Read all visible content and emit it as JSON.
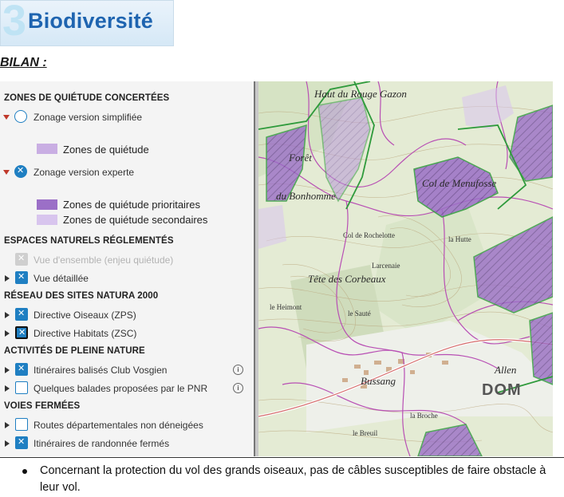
{
  "header": {
    "logo_number": "3",
    "logo_text": "Biodiversité",
    "bilan": "BILAN :"
  },
  "legend": {
    "zones_title": "ZONES DE QUIÉTUDE CONCERTÉES",
    "simplified_label": "Zonage version simplifiée",
    "zone_quietude": "Zones de quiétude",
    "expert_label": "Zonage version experte",
    "zone_prioritaires": "Zones de quiétude prioritaires",
    "zone_secondaires": "Zones de quiétude secondaires",
    "espaces_title": "ESPACES NATURELS RÉGLEMENTÉS",
    "vue_ensemble": "Vue d'ensemble (enjeu quiétude)",
    "vue_detaillee": "Vue détaillée",
    "natura_title": "RÉSEAU DES SITES NATURA 2000",
    "directive_oiseaux": "Directive Oiseaux (ZPS)",
    "directive_habitats": "Directive Habitats (ZSC)",
    "activites_title": "ACTIVITÉS DE PLEINE NATURE",
    "itineraires_club": "Itinéraires balisés Club Vosgien",
    "balades_pnr": "Quelques balades proposées par le PNR",
    "voies_title": "VOIES FERMÉES",
    "routes_dep": "Routes départementales non déneigées",
    "itineraires_fermes": "Itinéraires de randonnée fermés",
    "info_symbol": "i",
    "colors": {
      "quietude": "#c9aee3",
      "prioritaire": "#9b6fc7",
      "secondaire": "#d8c5ee",
      "accent": "#1f7fc2"
    }
  },
  "map": {
    "labels": {
      "haut_rouge_gazon": "Haut du Rouge Gazon",
      "foret": "Forêt",
      "du_bonhomme": "du Bonhomme",
      "col_de_menufosse": "Col de Menufosse",
      "tete_des_corbeaux": "Tête des Corbeaux",
      "col_rochelotte": "Col de Rochelotte",
      "la_hutte": "la Hutte",
      "larcenaie": "Larcenaie",
      "le_saute": "le Sauté",
      "le_heimont": "le Heimont",
      "bussang": "Bussang",
      "la_broche": "la Broche",
      "le_breuil": "le Breuil",
      "allenbach": "Allen",
      "dom": "DOM"
    }
  },
  "note": {
    "bullet": "Concernant la protection du vol des grands oiseaux, pas de câbles susceptibles de faire obstacle à leur vol."
  }
}
